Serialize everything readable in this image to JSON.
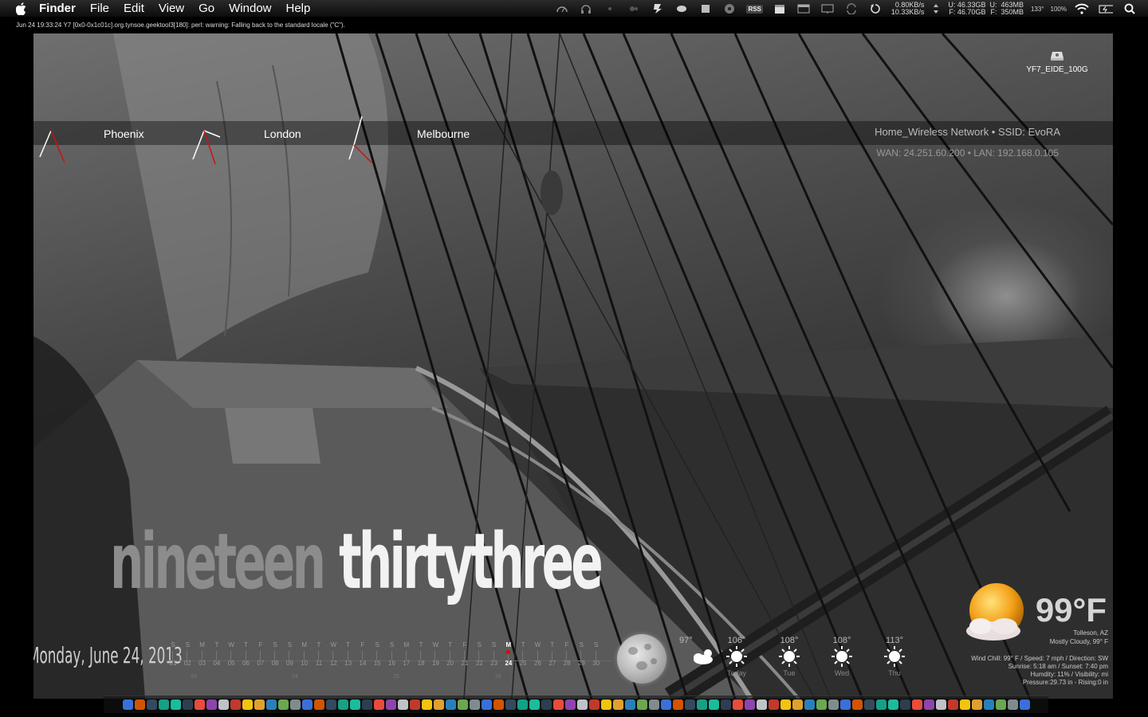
{
  "menubar": {
    "app_name": "Finder",
    "menus": [
      "File",
      "Edit",
      "View",
      "Go",
      "Window",
      "Help"
    ],
    "rss_label": "RSS",
    "network_speed": [
      "0.80KB/s",
      "10.33KB/s"
    ],
    "disk_used": "U: 46.33GB",
    "disk_free": "F: 46.70GB",
    "mem_u": "U:",
    "mem_f": "F:",
    "mem_used": "463MB",
    "mem_free": "350MB",
    "cpu_temp": "133°",
    "battery_percent": "100%"
  },
  "log_line": "Jun 24 19:33:24 Y7 [0x0-0x1c01c].org.tynsoe.geektool3[180]: perl: warning: Falling back to the standard locale (\"C\").",
  "desktop": {
    "disk_label": "YF7_EIDE_100G",
    "cities": [
      "Phoenix",
      "London",
      "Melbourne"
    ],
    "network_name": "Home_Wireless Network • SSID: EvoRA",
    "network_ips": "WAN: 24.251.60.200 • LAN: 192.168.0.105",
    "time_hour_words": "nineteen",
    "time_minute_words": "thirtythree",
    "date_text": "Monday, June 24, 2013"
  },
  "calendar": {
    "day_letters": [
      "S",
      "S",
      "M",
      "T",
      "W",
      "T",
      "F",
      "S",
      "S",
      "M",
      "T",
      "W",
      "T",
      "F",
      "S",
      "S",
      "M",
      "T",
      "W",
      "T",
      "F",
      "S",
      "S",
      "M",
      "T",
      "W",
      "T",
      "F",
      "S",
      "S"
    ],
    "day_numbers": [
      "01",
      "02",
      "03",
      "04",
      "05",
      "06",
      "07",
      "08",
      "09",
      "10",
      "11",
      "12",
      "13",
      "14",
      "15",
      "16",
      "17",
      "18",
      "19",
      "20",
      "21",
      "22",
      "23",
      "24",
      "25",
      "26",
      "27",
      "28",
      "29",
      "30"
    ],
    "today_index": 23,
    "week_numbers": [
      "23",
      "24",
      "25",
      "26"
    ]
  },
  "forecast": [
    {
      "temp": "97°",
      "label": ""
    },
    {
      "temp": "106°",
      "label": "Today"
    },
    {
      "temp": "108°",
      "label": "Tue"
    },
    {
      "temp": "108°",
      "label": "Wed"
    },
    {
      "temp": "113°",
      "label": "Thu"
    }
  ],
  "weather": {
    "current_temp": "99°F",
    "location": "Tolleson, AZ",
    "condition": "Mostly Cloudy, 99° F",
    "wind": "Wind Chill: 99° F / Speed: 7 mph / Direction: SW",
    "sun": "Sunrise: 5:18 am / Sunset: 7:40 pm",
    "humidity": "Humdity: 11% / Visibility: mi",
    "pressure": "Pressure:29.73 in - Rising:0 in"
  },
  "colors": {
    "accent_red": "#cc1111",
    "menubar_bg": "#141414"
  }
}
